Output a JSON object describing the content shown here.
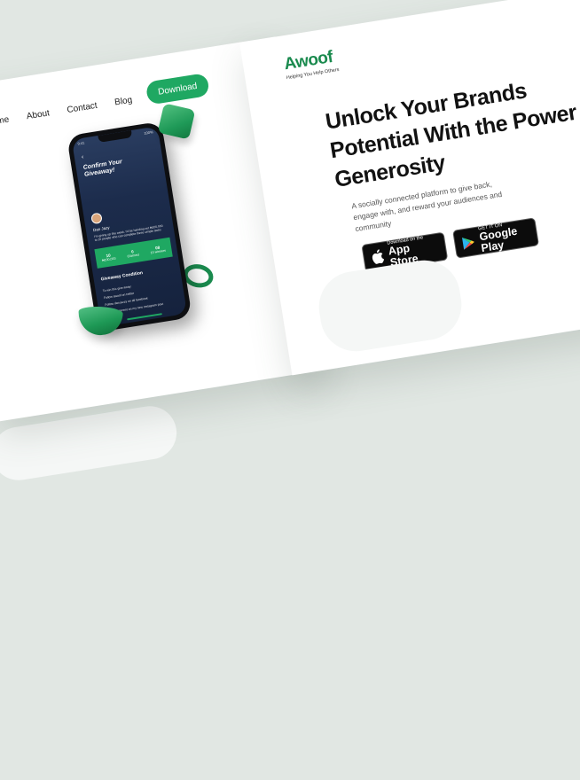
{
  "nav": {
    "items": [
      "me",
      "About",
      "Contact",
      "Blog"
    ],
    "download_label": "Download"
  },
  "phone_screen": {
    "status_time": "9:41",
    "status_icons": "100%",
    "back_icon": "chevron-left-icon",
    "title": "Confirm Your Giveaway!",
    "user_name": "Dan Jazy",
    "description": "I'm giving up this week. I'd be handing out ₦100,000 to 10 people who can complete these simple tasks",
    "stats": [
      {
        "value": "10",
        "label": "₦100,000"
      },
      {
        "value": "0",
        "label": "Claimed"
      },
      {
        "value": "08",
        "label": "10 winners"
      }
    ],
    "condition_title": "Giveaway Condition",
    "conditions": [
      "To win this give away:",
      "Follow awoof on twitter",
      "Follow dan jazzy on all facebook",
      "Like & comment on my new Instagram post"
    ]
  },
  "brand": {
    "name": "Awoof",
    "tagline": "Helping You Help Others",
    "accent_color": "#1fa862"
  },
  "hero": {
    "headline": "Unlock Your Brands Potential With the Power of Generosity",
    "subtext": "A socially connected platform to give back, engage with, and reward your audiences and community"
  },
  "stores": {
    "apple_small": "Download on the",
    "apple_big": "App Store",
    "google_small": "GET IT ON",
    "google_big": "Google Play"
  }
}
